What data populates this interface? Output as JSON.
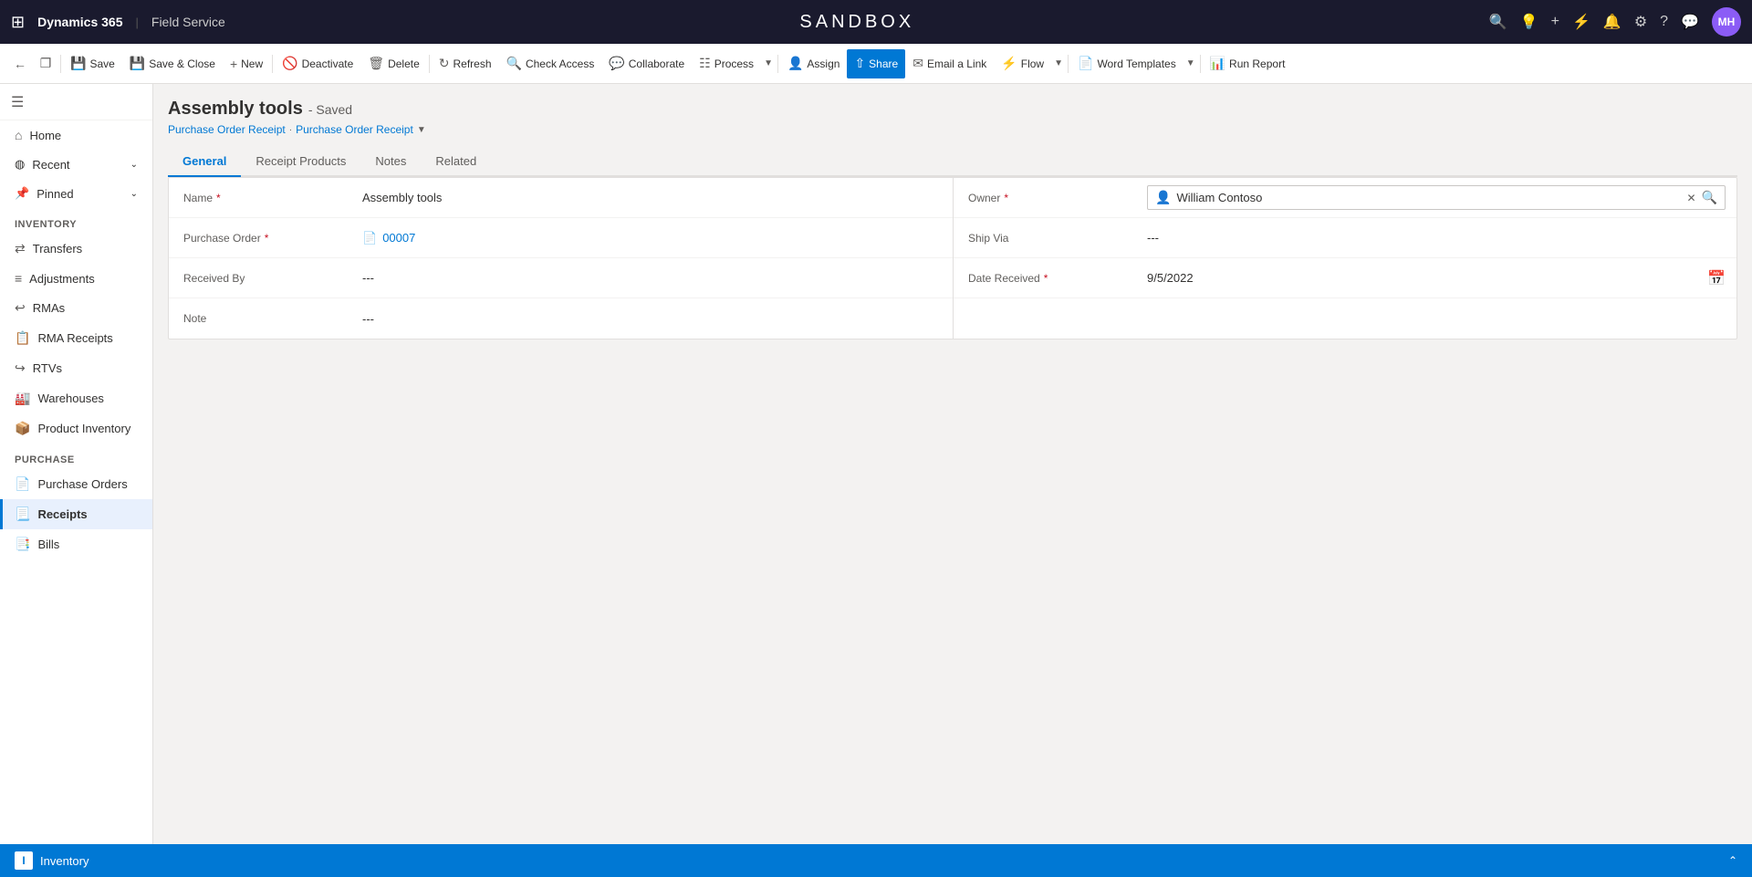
{
  "topnav": {
    "waffle_icon": "⊞",
    "brand": "Dynamics 365",
    "separator": "|",
    "module": "Field Service",
    "title": "SANDBOX",
    "icons": {
      "search": "🔍",
      "lightbulb": "💡",
      "plus": "+",
      "filter": "⚡",
      "bell": "🔔",
      "settings": "⚙",
      "question": "?",
      "chat": "💬"
    },
    "avatar_initials": "MH"
  },
  "toolbar": {
    "back_title": "Back",
    "detach_title": "Open in new window",
    "save_label": "Save",
    "save_close_label": "Save & Close",
    "new_label": "New",
    "deactivate_label": "Deactivate",
    "delete_label": "Delete",
    "refresh_label": "Refresh",
    "check_access_label": "Check Access",
    "collaborate_label": "Collaborate",
    "process_label": "Process",
    "assign_label": "Assign",
    "share_label": "Share",
    "email_link_label": "Email a Link",
    "flow_label": "Flow",
    "word_templates_label": "Word Templates",
    "run_report_label": "Run Report"
  },
  "sidebar": {
    "hamburger_icon": "☰",
    "home_label": "Home",
    "recent_label": "Recent",
    "pinned_label": "Pinned",
    "sections": [
      {
        "name": "Inventory",
        "items": [
          {
            "label": "Transfers",
            "icon": "⇄"
          },
          {
            "label": "Adjustments",
            "icon": "≡"
          },
          {
            "label": "RMAs",
            "icon": "↩"
          },
          {
            "label": "RMA Receipts",
            "icon": "📋"
          },
          {
            "label": "RTVs",
            "icon": "↪"
          },
          {
            "label": "Warehouses",
            "icon": "🏭"
          },
          {
            "label": "Product Inventory",
            "icon": "📦"
          }
        ]
      },
      {
        "name": "Purchase",
        "items": [
          {
            "label": "Purchase Orders",
            "icon": "📄"
          },
          {
            "label": "Receipts",
            "icon": "📃",
            "active": true
          },
          {
            "label": "Bills",
            "icon": "📑"
          }
        ]
      }
    ]
  },
  "page": {
    "title": "Assembly tools",
    "status": "- Saved",
    "breadcrumb": [
      {
        "label": "Purchase Order Receipt",
        "link": true
      },
      {
        "separator": "·"
      },
      {
        "label": "Purchase Order Receipt",
        "link": true,
        "has_chevron": true
      }
    ]
  },
  "tabs": [
    {
      "label": "General",
      "active": true
    },
    {
      "label": "Receipt Products"
    },
    {
      "label": "Notes"
    },
    {
      "label": "Related"
    }
  ],
  "form": {
    "fields_left": [
      {
        "label": "Name",
        "required": true,
        "value": "Assembly tools",
        "type": "text"
      },
      {
        "label": "Purchase Order",
        "required": true,
        "value": "00007",
        "type": "link",
        "icon": "📄"
      },
      {
        "label": "Received By",
        "required": false,
        "value": "---",
        "type": "text"
      },
      {
        "label": "Note",
        "required": false,
        "value": "---",
        "type": "text"
      }
    ],
    "fields_right": [
      {
        "label": "Owner",
        "required": true,
        "value": "William Contoso",
        "type": "owner"
      },
      {
        "label": "Ship Via",
        "required": false,
        "value": "---",
        "type": "text"
      },
      {
        "label": "Date Received",
        "required": true,
        "value": "9/5/2022",
        "type": "date"
      }
    ]
  },
  "bottombar": {
    "icon": "I",
    "label": "Inventory",
    "chevron": "⌃"
  }
}
